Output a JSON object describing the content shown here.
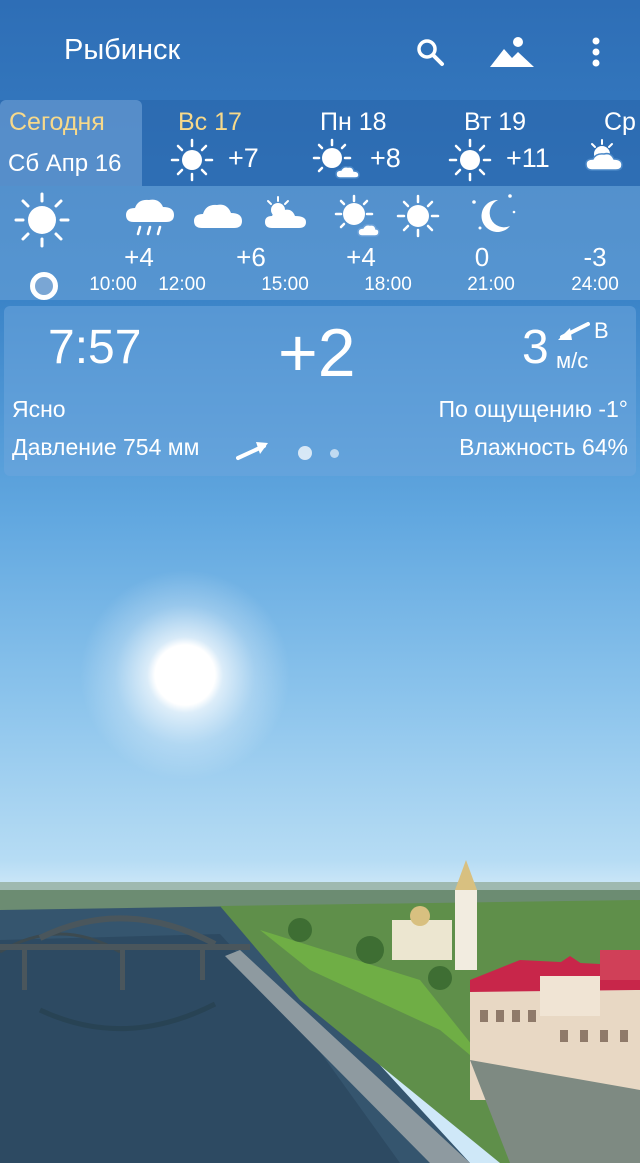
{
  "app_bar": {
    "city": "Рыбинск",
    "search_icon": "search-icon",
    "background_icon": "mountains-icon",
    "menu_icon": "more-vert-icon"
  },
  "days": {
    "today": {
      "label": "Сегодня",
      "date": "Сб Апр 16"
    },
    "forecast": [
      {
        "label": "Вс 17",
        "temp": "+7",
        "icon": "sun-icon"
      },
      {
        "label": "Пн 18",
        "temp": "+8",
        "icon": "sun-cloud-icon"
      },
      {
        "label": "Вт 19",
        "temp": "+11",
        "icon": "sun-icon"
      },
      {
        "label": "Ср",
        "icon": "sun-cloud-icon"
      }
    ]
  },
  "hourly": {
    "icons": [
      "sun-icon",
      "rain-cloud-icon",
      "cloud-icon",
      "sun-cloud-icon",
      "sun-cloud-icon",
      "sun-icon",
      "moon-stars-icon"
    ],
    "temps": [
      "+4",
      "+6",
      "+4",
      "0",
      "-3"
    ],
    "times": [
      "10:00",
      "12:00",
      "15:00",
      "18:00",
      "21:00",
      "24:00"
    ]
  },
  "current": {
    "time": "7:57",
    "temperature": "+2",
    "wind_speed": "3",
    "wind_direction": "В",
    "wind_unit": "м/с",
    "condition": "Ясно",
    "feels_like": "По ощущению -1°",
    "pressure": "Давление 754 мм",
    "humidity": "Влажность 64%"
  },
  "colors": {
    "accent_today": "#f7d98a",
    "sky_top": "#2e6eb6",
    "sky_horizon": "#cfe8f8"
  }
}
